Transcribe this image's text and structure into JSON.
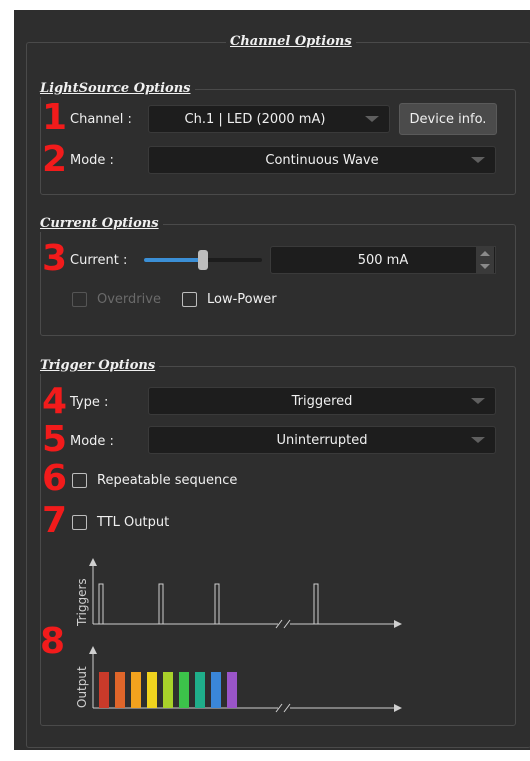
{
  "panel": {
    "title": "Channel Options"
  },
  "lightsource": {
    "title": "LightSource Options",
    "channel_label": "Channel :",
    "channel_value": "Ch.1 | LED (2000 mA)",
    "device_info_label": "Device info.",
    "mode_label": "Mode :",
    "mode_value": "Continuous Wave"
  },
  "current": {
    "title": "Current Options",
    "current_label": "Current :",
    "current_value": "500 mA",
    "slider_fraction": 0.5,
    "overdrive_label": "Overdrive",
    "overdrive_checked": false,
    "lowpower_label": "Low-Power",
    "lowpower_checked": false
  },
  "trigger": {
    "title": "Trigger Options",
    "type_label": "Type :",
    "type_value": "Triggered",
    "mode_label": "Mode :",
    "mode_value": "Uninterrupted",
    "repeatable_label": "Repeatable sequence",
    "ttl_label": "TTL Output"
  },
  "annotations": [
    "1",
    "2",
    "3",
    "4",
    "5",
    "6",
    "7",
    "8"
  ],
  "diagram": {
    "triggers_label": "Triggers",
    "output_label": "Output",
    "output_colors": [
      "#c93a2a",
      "#e0662a",
      "#f2a21e",
      "#f0d31e",
      "#a8d12a",
      "#3cc24a",
      "#1fae8a",
      "#3a86d8",
      "#9a55c8"
    ]
  },
  "colors": {
    "annotation": "#f21b1b",
    "panel_bg": "#2e2e2e",
    "slider_fill": "#3b8fd6"
  }
}
